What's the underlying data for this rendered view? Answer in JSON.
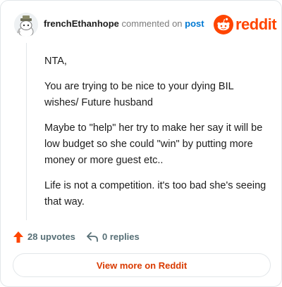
{
  "header": {
    "username": "frenchEthanhope",
    "commented_on": "commented on",
    "post_link": "post",
    "brand_word": "reddit"
  },
  "comment": {
    "paragraphs": [
      "NTA,",
      "You are trying to be nice to your dying BIL wishes/ Future husband",
      "Maybe to \"help\" her try to make her say it will be low budget so she could \"win\" by putting more money or more guest etc..",
      "Life is not a competition. it's too bad she's seeing that way."
    ]
  },
  "actions": {
    "upvotes_label": "28 upvotes",
    "replies_label": "0 replies"
  },
  "footer": {
    "view_more_label": "View more on Reddit"
  },
  "colors": {
    "brand": "#ff4500",
    "link": "#0079d3",
    "view_more": "#d93a00",
    "muted": "#576f76"
  },
  "icons": {
    "avatar": "snoo-avatar-icon",
    "brand": "reddit-logo-icon",
    "upvote": "upvote-arrow-icon",
    "reply": "reply-arrow-icon"
  }
}
